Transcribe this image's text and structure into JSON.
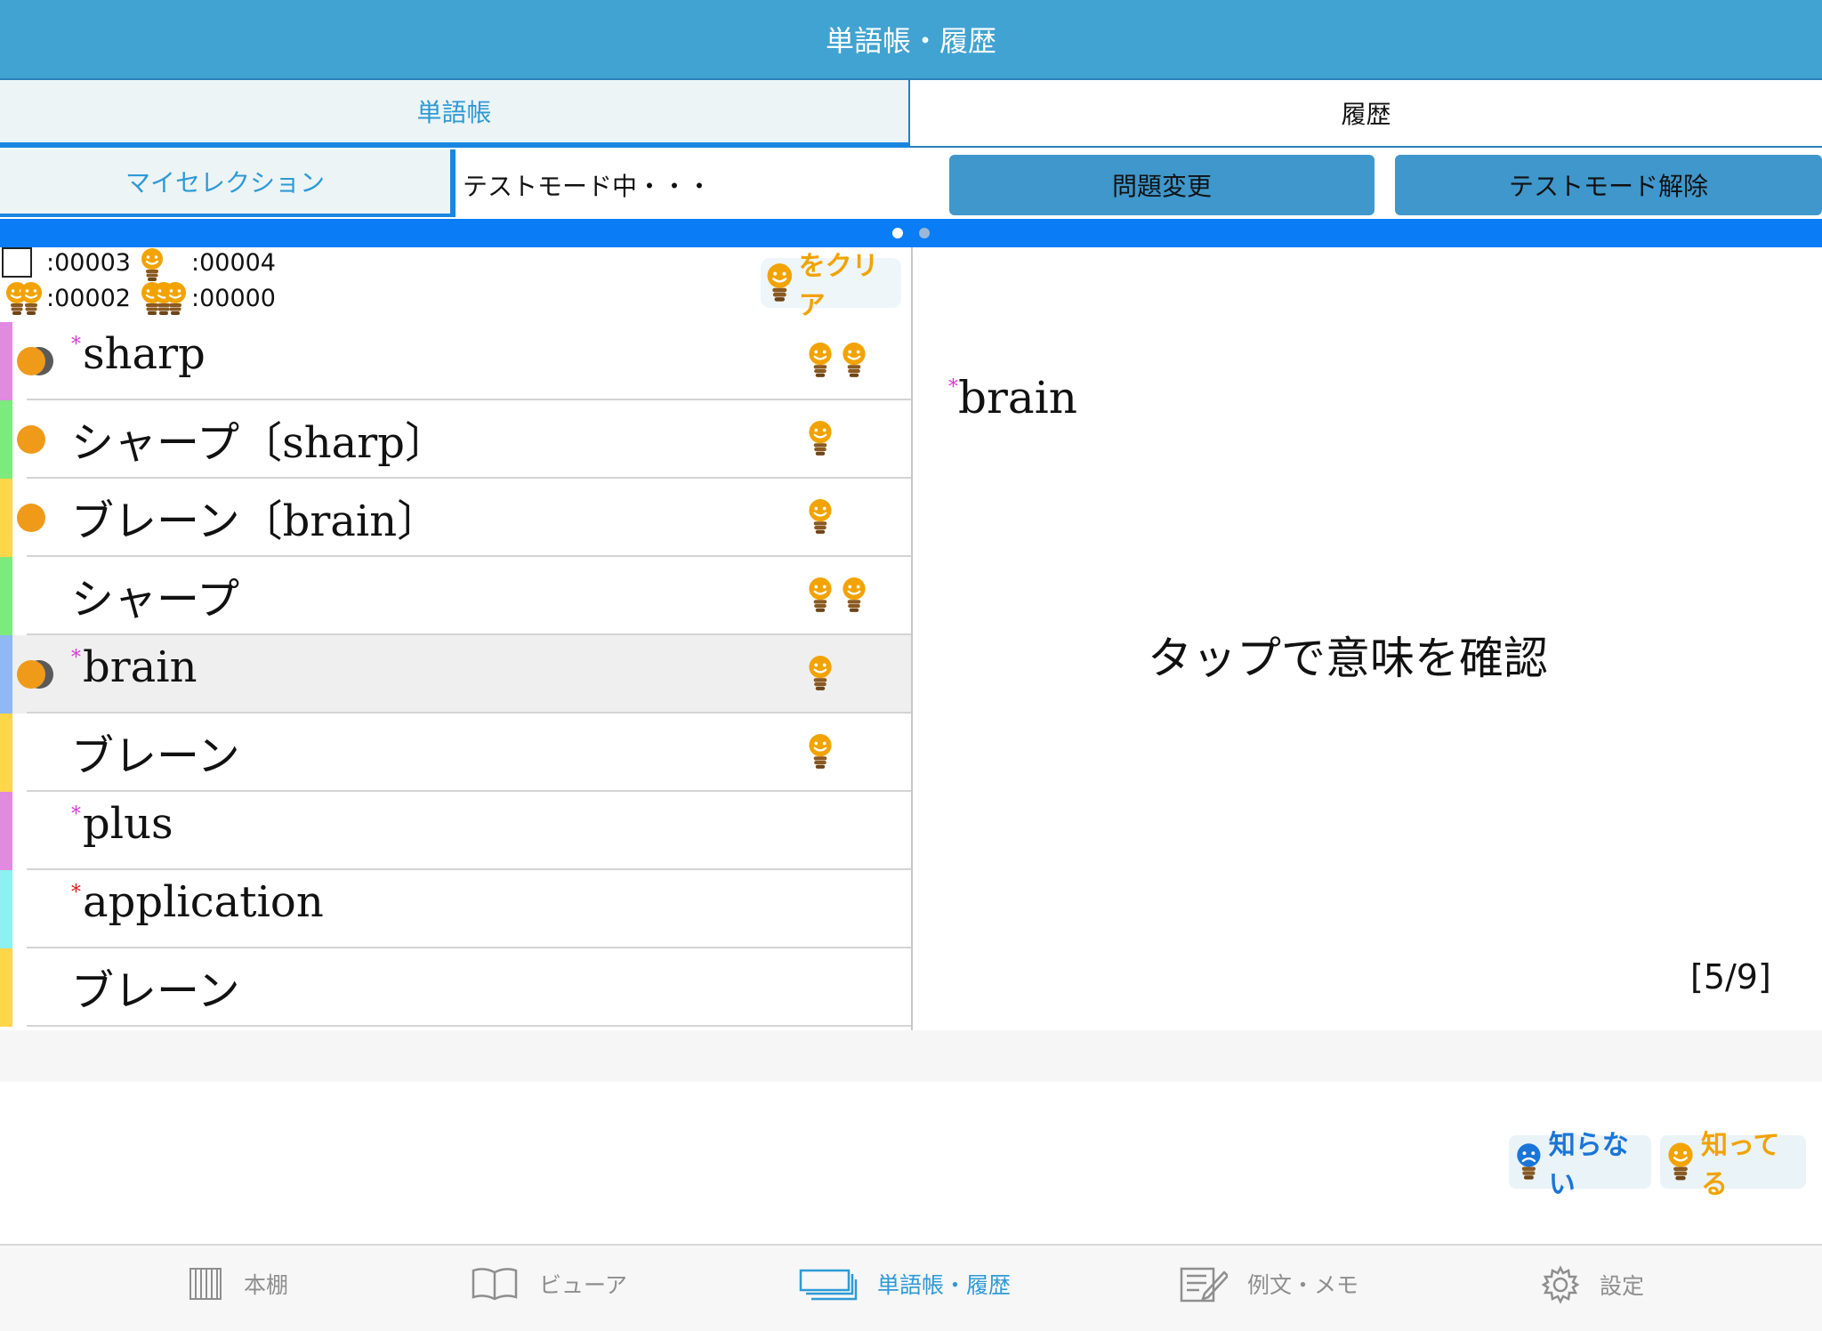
{
  "title": "単語帳・履歴",
  "tabs": {
    "wordbook": "単語帳",
    "history": "履歴"
  },
  "toolbar": {
    "my_selection": "マイセレクション",
    "status": "テストモード中・・・",
    "change_question": "問題変更",
    "exit_test_mode": "テストモード解除"
  },
  "stats": {
    "unmarked": ":00003",
    "one_bulb": ":00004",
    "two_bulbs": ":00002",
    "three_bulbs": ":00000"
  },
  "clear_label": "をクリア",
  "words": [
    {
      "text": "sharp",
      "star": "*",
      "bar_color": "#e08ae0",
      "circles": "double",
      "bulbs": 2,
      "selected": false
    },
    {
      "text": "シャープ〔sharp〕",
      "star": "",
      "bar_color": "#7dea7d",
      "circles": "single",
      "bulbs": 1,
      "selected": false
    },
    {
      "text": "ブレーン〔brain〕",
      "star": "",
      "bar_color": "#ffd54a",
      "circles": "single",
      "bulbs": 1,
      "selected": false
    },
    {
      "text": "シャープ",
      "star": "",
      "bar_color": "#7dea7d",
      "circles": "none",
      "bulbs": 2,
      "selected": false
    },
    {
      "text": "brain",
      "star": "*",
      "bar_color": "#8fb8f5",
      "circles": "double",
      "bulbs": 1,
      "selected": true
    },
    {
      "text": "ブレーン",
      "star": "",
      "bar_color": "#ffd54a",
      "circles": "none",
      "bulbs": 1,
      "selected": false
    },
    {
      "text": "plus",
      "star": "*",
      "bar_color": "#e08ae0",
      "circles": "none",
      "bulbs": 0,
      "selected": false
    },
    {
      "text": "application",
      "star": "*",
      "star_color": "red",
      "bar_color": "#8ef0f0",
      "circles": "none",
      "bulbs": 0,
      "selected": false
    },
    {
      "text": "ブレーン",
      "star": "",
      "bar_color": "#ffd54a",
      "circles": "none",
      "bulbs": 0,
      "selected": false
    }
  ],
  "detail": {
    "star": "*",
    "word": "brain",
    "hint": "タップで意味を確認",
    "counter": "[5/9]"
  },
  "know_buttons": {
    "unknown": "知らない",
    "known": "知ってる"
  },
  "tabbar": {
    "bookshelf": "本棚",
    "viewer": "ビューア",
    "wordbook_history": "単語帳・履歴",
    "examples_memo": "例文・メモ",
    "settings": "設定"
  },
  "colors": {
    "header": "#41a3d1",
    "accent": "#1b86e0",
    "button": "#3f97cb",
    "bulb_orange": "#f2a300",
    "bulb_blue": "#1b75d8"
  },
  "pager": {
    "pages": 2,
    "current": 1
  }
}
